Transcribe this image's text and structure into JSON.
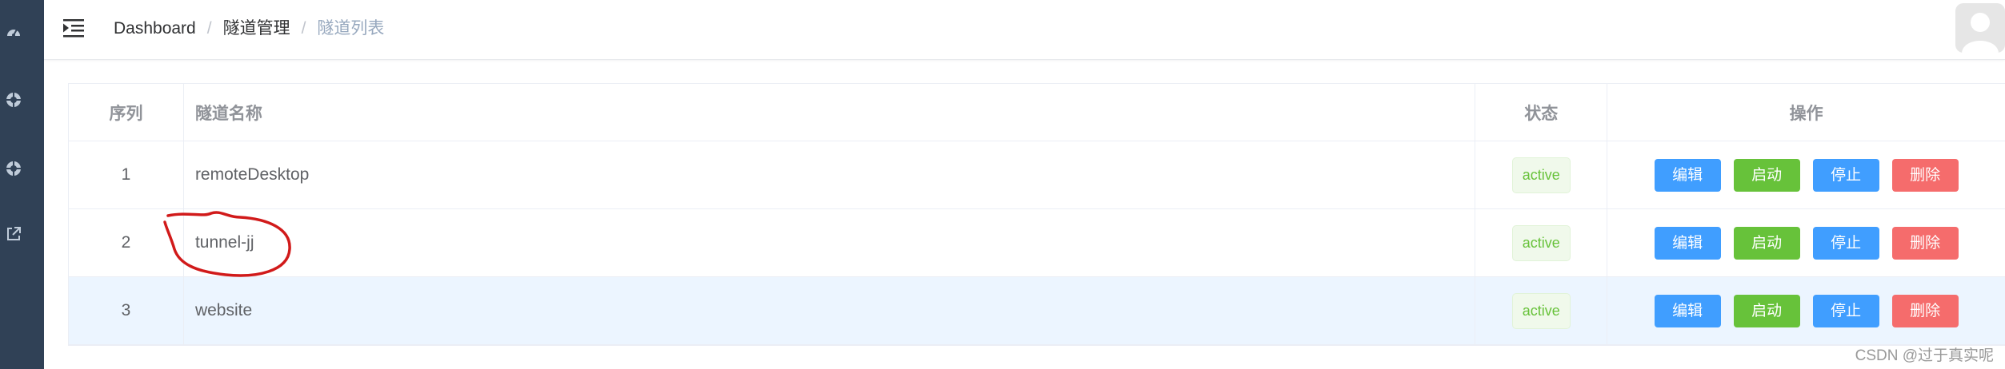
{
  "sidebar": {
    "items": [
      {
        "icon": "dashboard-icon"
      },
      {
        "icon": "tunnel-icon"
      },
      {
        "icon": "tunnel-list-icon"
      },
      {
        "icon": "external-link-icon"
      }
    ]
  },
  "header": {
    "breadcrumb": [
      "Dashboard",
      "隧道管理",
      "隧道列表"
    ],
    "separator": "/"
  },
  "table": {
    "columns": [
      "序列",
      "隧道名称",
      "状态",
      "操作"
    ],
    "rows": [
      {
        "index": "1",
        "name": "remoteDesktop",
        "status": "active"
      },
      {
        "index": "2",
        "name": "tunnel-jj",
        "status": "active"
      },
      {
        "index": "3",
        "name": "website",
        "status": "active"
      }
    ],
    "actions": {
      "edit": "编辑",
      "start": "启动",
      "stop": "停止",
      "delete": "删除"
    }
  },
  "watermark": "CSDN @过于真实呢",
  "colors": {
    "sidebar": "#304156",
    "primary": "#409eff",
    "success": "#67c23a",
    "danger": "#f56c6c",
    "annotation": "#d11a1a"
  }
}
